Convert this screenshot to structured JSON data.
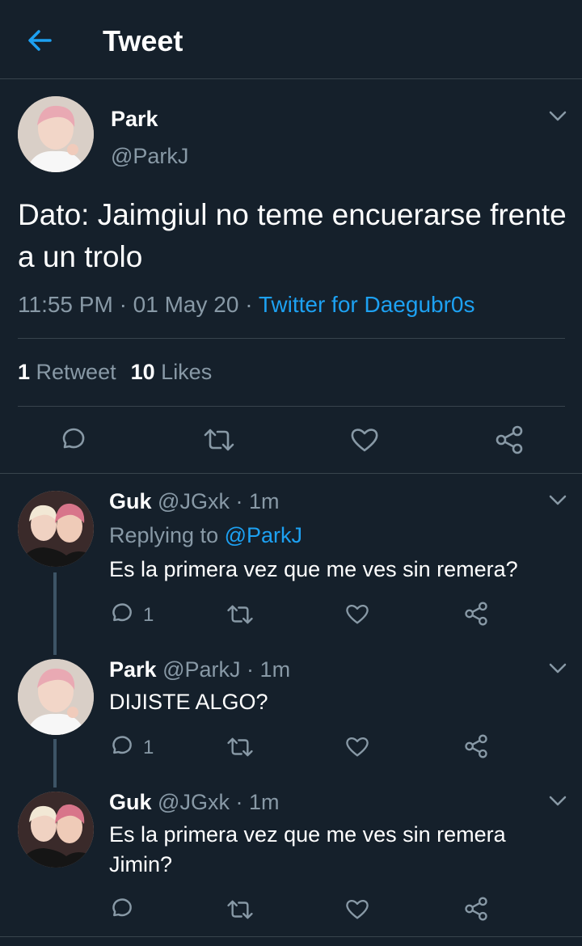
{
  "header": {
    "title": "Tweet"
  },
  "main_tweet": {
    "name": "Park",
    "handle": "@ParkJ",
    "text": "Dato: Jaimgiul no teme encuerarse frente a un trolo",
    "time": "11:55 PM",
    "separator": "·",
    "date": "01 May 20",
    "source": "Twitter for Daegubr0s",
    "retweets_count": "1",
    "retweets_label": "Retweet",
    "likes_count": "10",
    "likes_label": "Likes"
  },
  "replies": [
    {
      "name": "Guk",
      "handle": "@JGxk",
      "separator": "·",
      "time": "1m",
      "replying_prefix": "Replying to",
      "replying_to": "@ParkJ",
      "text": "Es la primera vez que me ves sin remera?",
      "reply_count": "1"
    },
    {
      "name": "Park",
      "handle": "@ParkJ",
      "separator": "·",
      "time": "1m",
      "text": "DIJISTE ALGO?",
      "reply_count": "1"
    },
    {
      "name": "Guk",
      "handle": "@JGxk",
      "separator": "·",
      "time": "1m",
      "text_line1": "Es la primera vez que me ves sin remera",
      "text_line2": "Jimin?"
    }
  ],
  "colors": {
    "background": "#15202b",
    "accent": "#1da1f2",
    "secondary_text": "#8899a6",
    "divider": "#38444d"
  },
  "icons": [
    "back-arrow-icon",
    "chevron-down-icon",
    "reply-icon",
    "retweet-icon",
    "like-icon",
    "share-icon"
  ]
}
